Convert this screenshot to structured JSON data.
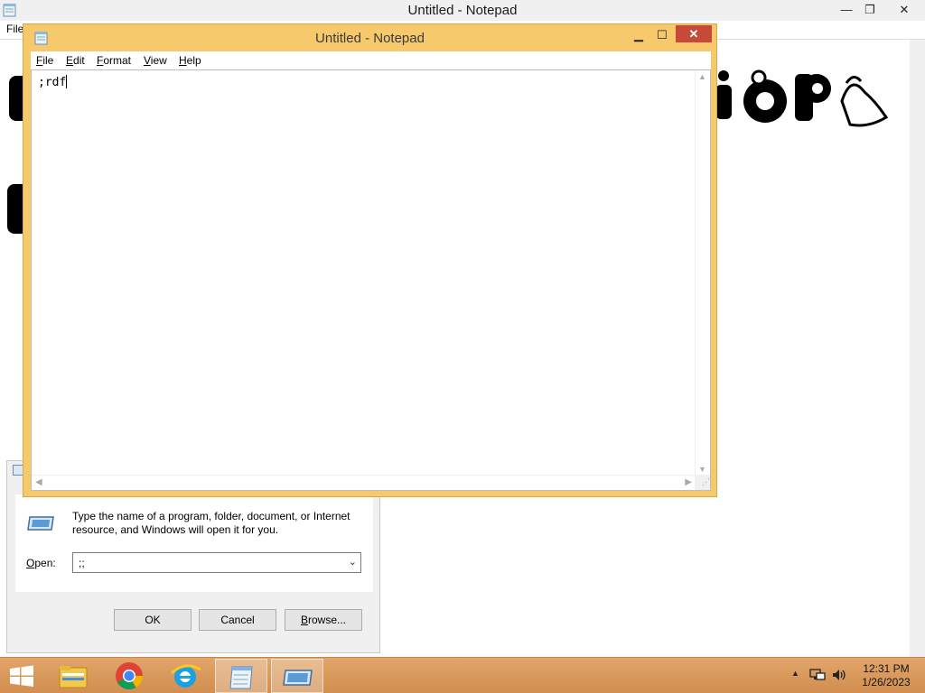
{
  "background_window": {
    "title": "Untitled - Notepad",
    "menu_file": "File",
    "controls": {
      "minimize": "—",
      "maximize": "❐",
      "close": "✕"
    }
  },
  "notepad": {
    "title": "Untitled - Notepad",
    "controls": {
      "minimize": "▁",
      "maximize": "☐",
      "close": "✕"
    },
    "menu": [
      {
        "label": "File",
        "underline": "F",
        "rest": "ile"
      },
      {
        "label": "Edit",
        "underline": "E",
        "rest": "dit"
      },
      {
        "label": "Format",
        "underline": "F",
        "rest": "ormat"
      },
      {
        "label": "View",
        "underline": "V",
        "rest": "iew"
      },
      {
        "label": "Help",
        "underline": "H",
        "rest": "elp"
      }
    ],
    "text": ";rdf",
    "scroll_arrows": {
      "up": "▲",
      "down": "▼",
      "left": "◀",
      "right": "▶"
    },
    "grip": "⋰"
  },
  "run_dialog": {
    "description": "Type the name of a program, folder, document, or Internet resource, and Windows will open it for you.",
    "open_label_underline": "O",
    "open_label_rest": "pen:",
    "open_value": ";;",
    "combo_arrow": "⌄",
    "ok_label": "OK",
    "cancel_label": "Cancel",
    "browse_label_underline": "B",
    "browse_label_rest": "rowse..."
  },
  "taskbar": {
    "tray_up": "▲",
    "time": "12:31 PM",
    "date": "1/26/2023"
  },
  "colors": {
    "notepad_frame": "#f5c96c",
    "close_button": "#c7493a",
    "taskbar": "#d99b5d"
  }
}
